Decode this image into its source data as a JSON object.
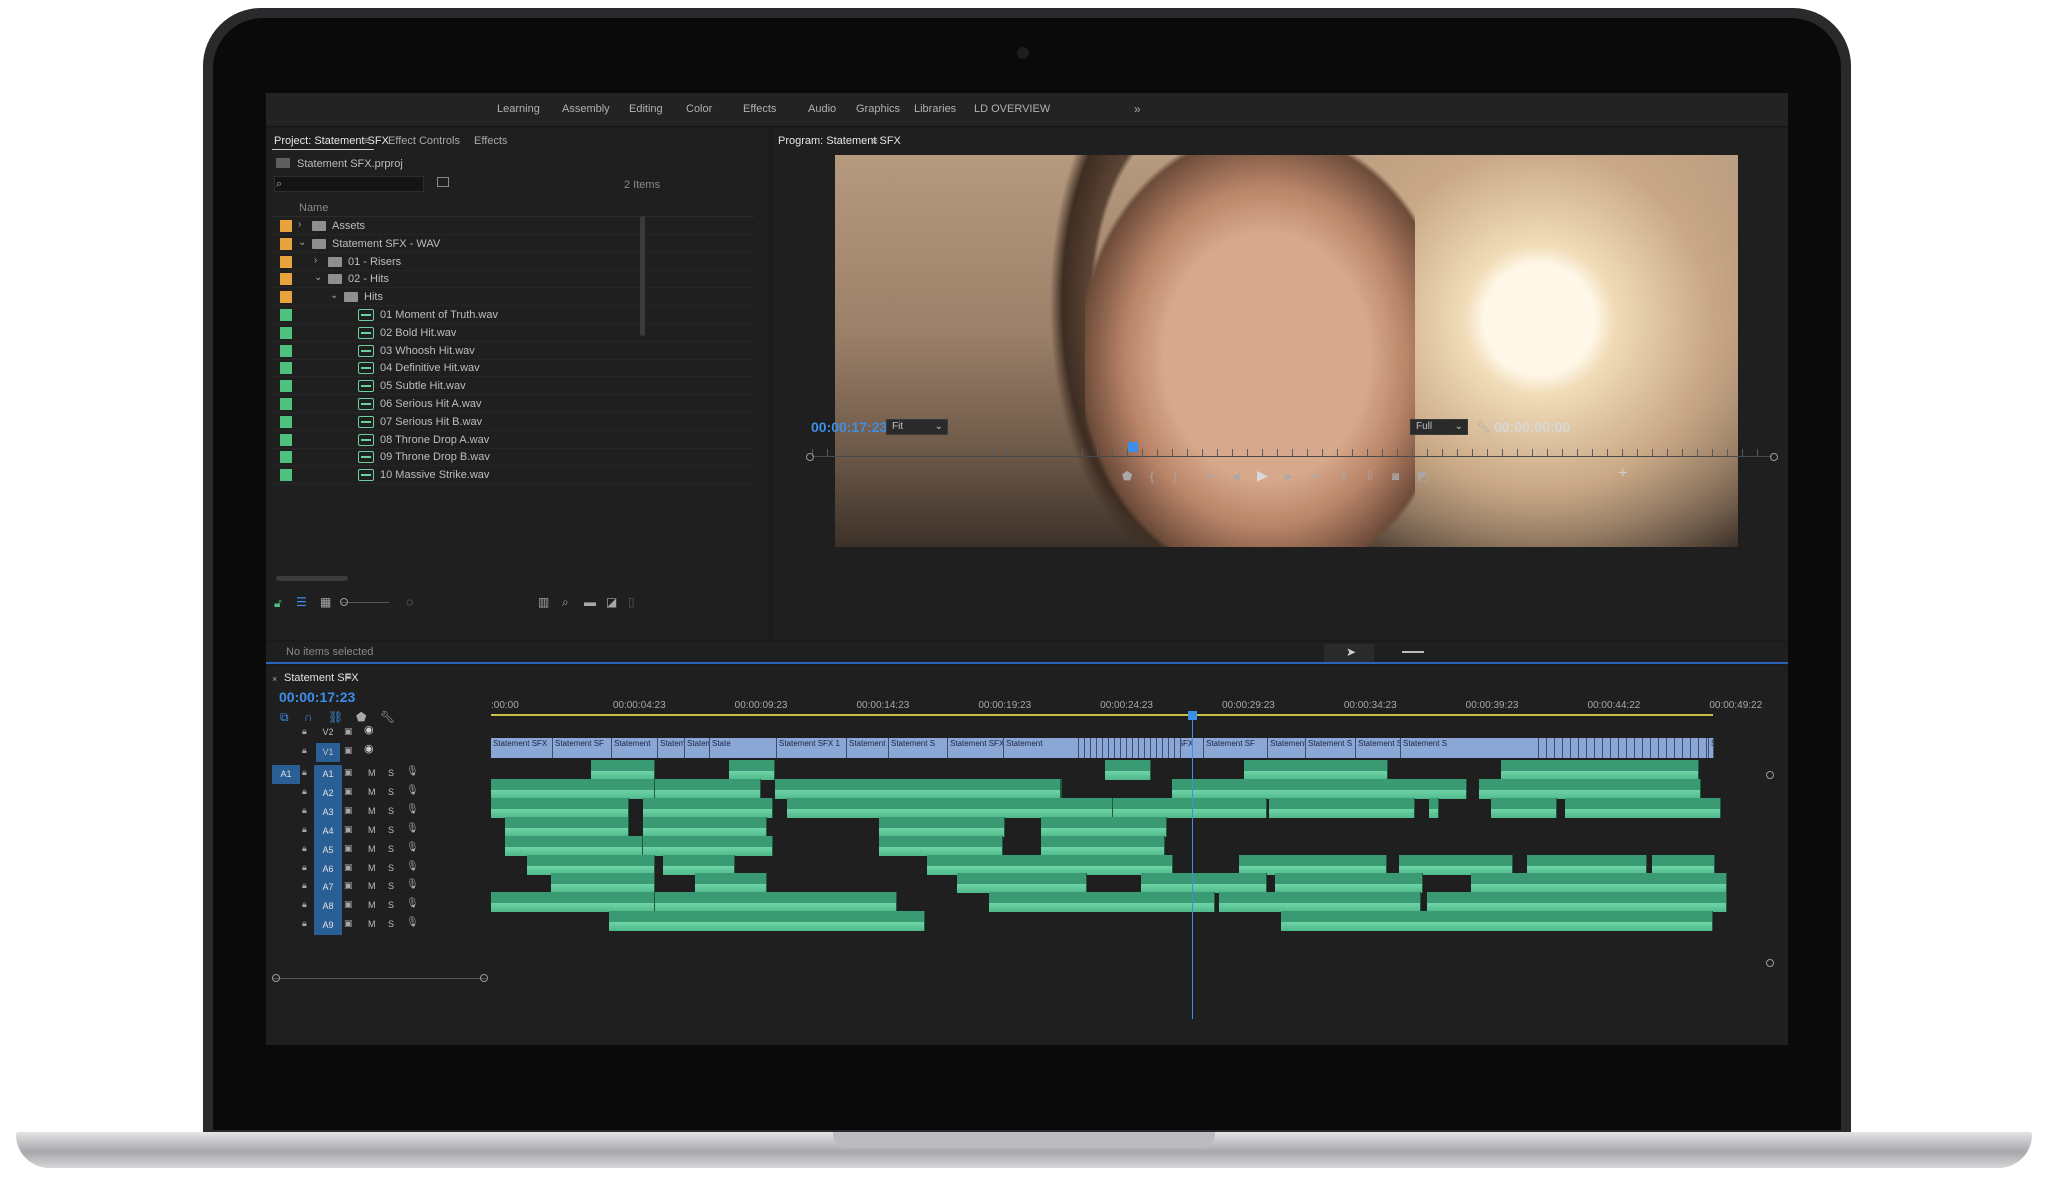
{
  "workspaces": [
    "Learning",
    "Assembly",
    "Editing",
    "Color",
    "Effects",
    "Audio",
    "Graphics",
    "Libraries",
    "LD OVERVIEW"
  ],
  "workspaces_more_icon": "double-chevron-right",
  "project_panel": {
    "tabs": [
      "Project: Statement SFX",
      "Effect Controls",
      "Effects"
    ],
    "menu_icon": "hamburger",
    "project_file": "Statement SFX.prproj",
    "search_placeholder": "",
    "item_count": "2 Items",
    "column_name": "Name",
    "colors": {
      "folder_label": "#e8a33e",
      "audio_label": "#4fc17f"
    },
    "items": [
      {
        "name": "Assets",
        "type": "folder",
        "indent": 0,
        "expanded": false,
        "label": "orange"
      },
      {
        "name": "Statement SFX - WAV",
        "type": "folder",
        "indent": 0,
        "expanded": true,
        "label": "orange"
      },
      {
        "name": "01 - Risers",
        "type": "folder",
        "indent": 1,
        "expanded": false,
        "label": "orange"
      },
      {
        "name": "02 - Hits",
        "type": "folder",
        "indent": 1,
        "expanded": true,
        "label": "orange"
      },
      {
        "name": "Hits",
        "type": "folder",
        "indent": 2,
        "expanded": true,
        "label": "orange"
      },
      {
        "name": "01 Moment of Truth.wav",
        "type": "audio",
        "indent": 3,
        "label": "green"
      },
      {
        "name": "02 Bold Hit.wav",
        "type": "audio",
        "indent": 3,
        "label": "green"
      },
      {
        "name": "03 Whoosh Hit.wav",
        "type": "audio",
        "indent": 3,
        "label": "green"
      },
      {
        "name": "04 Definitive Hit.wav",
        "type": "audio",
        "indent": 3,
        "label": "green"
      },
      {
        "name": "05 Subtle Hit.wav",
        "type": "audio",
        "indent": 3,
        "label": "green"
      },
      {
        "name": "06 Serious Hit A.wav",
        "type": "audio",
        "indent": 3,
        "label": "green"
      },
      {
        "name": "07 Serious Hit B.wav",
        "type": "audio",
        "indent": 3,
        "label": "green"
      },
      {
        "name": "08 Throne Drop A.wav",
        "type": "audio",
        "indent": 3,
        "label": "green"
      },
      {
        "name": "09 Throne Drop B.wav",
        "type": "audio",
        "indent": 3,
        "label": "green"
      },
      {
        "name": "10 Massive Strike.wav",
        "type": "audio",
        "indent": 3,
        "label": "green"
      }
    ]
  },
  "program_monitor": {
    "title": "Program: Statement SFX",
    "timecode_current": "00:00:17:23",
    "zoom": "Fit",
    "resolution": "Full",
    "timecode_duration": "00:00:00:00",
    "playhead_fraction": 0.334
  },
  "status": {
    "text": "No items selected"
  },
  "timeline": {
    "sequence_name": "Statement SFX",
    "timecode": "00:00:17:23",
    "ruler": [
      ":00:00",
      "00:00:04:23",
      "00:00:09:23",
      "00:00:14:23",
      "00:00:19:23",
      "00:00:24:23",
      "00:00:29:23",
      "00:00:34:23",
      "00:00:39:23",
      "00:00:44:22",
      "00:00:49:22"
    ],
    "video_tracks": [
      "V2",
      "V1"
    ],
    "audio_tracks": [
      "A1",
      "A2",
      "A3",
      "A4",
      "A5",
      "A6",
      "A7",
      "A8",
      "A9"
    ],
    "source_patch": "A1",
    "track_buttons": {
      "mute": "M",
      "solo": "S"
    },
    "video_clip_label": "Statement SFX",
    "video_clip_labels": [
      "Statement SFX",
      "Statement SF",
      "Statement",
      "Statem",
      "Statem",
      "State",
      "Statement SFX 1",
      "Statement",
      "Statement S",
      "Statement SFX",
      "Statement",
      "Statement SFX",
      "Statement SFX",
      "Statement SF",
      "Statement S",
      "Statement S",
      "Statement S",
      "Statement S",
      "State"
    ],
    "accent": "#3d8ee8",
    "audio_clip_color": "#3a9a73",
    "video_clip_color": "#8ba7d6"
  }
}
